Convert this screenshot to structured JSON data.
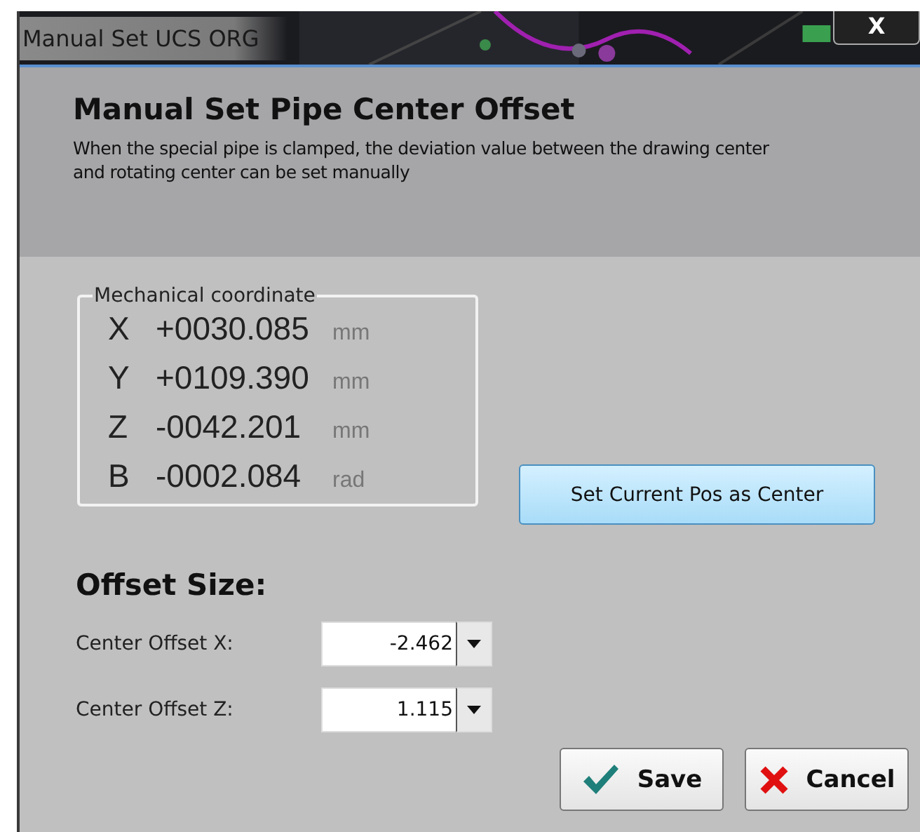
{
  "window": {
    "title": "Manual Set UCS ORG",
    "close": "X"
  },
  "header": {
    "title": "Manual Set Pipe Center Offset",
    "description": "When the special pipe is clamped, the deviation value between the drawing center\nand rotating center can be set manually"
  },
  "coordinates": {
    "legend": "Mechanical coordinate",
    "rows": [
      {
        "axis": "X",
        "value": "+0030.085",
        "unit": "mm"
      },
      {
        "axis": "Y",
        "value": "+0109.390",
        "unit": "mm"
      },
      {
        "axis": "Z",
        "value": "-0042.201",
        "unit": "mm"
      },
      {
        "axis": "B",
        "value": "-0002.084",
        "unit": "rad"
      }
    ]
  },
  "set_center_button": "Set Current Pos as Center",
  "offset": {
    "title": "Offset Size:",
    "fields": [
      {
        "label": "Center Offset X:",
        "value": "-2.462"
      },
      {
        "label": "Center Offset Z:",
        "value": "1.115"
      }
    ]
  },
  "buttons": [
    {
      "kind": "save",
      "label": "Save"
    },
    {
      "kind": "cancel",
      "label": "Cancel"
    }
  ]
}
